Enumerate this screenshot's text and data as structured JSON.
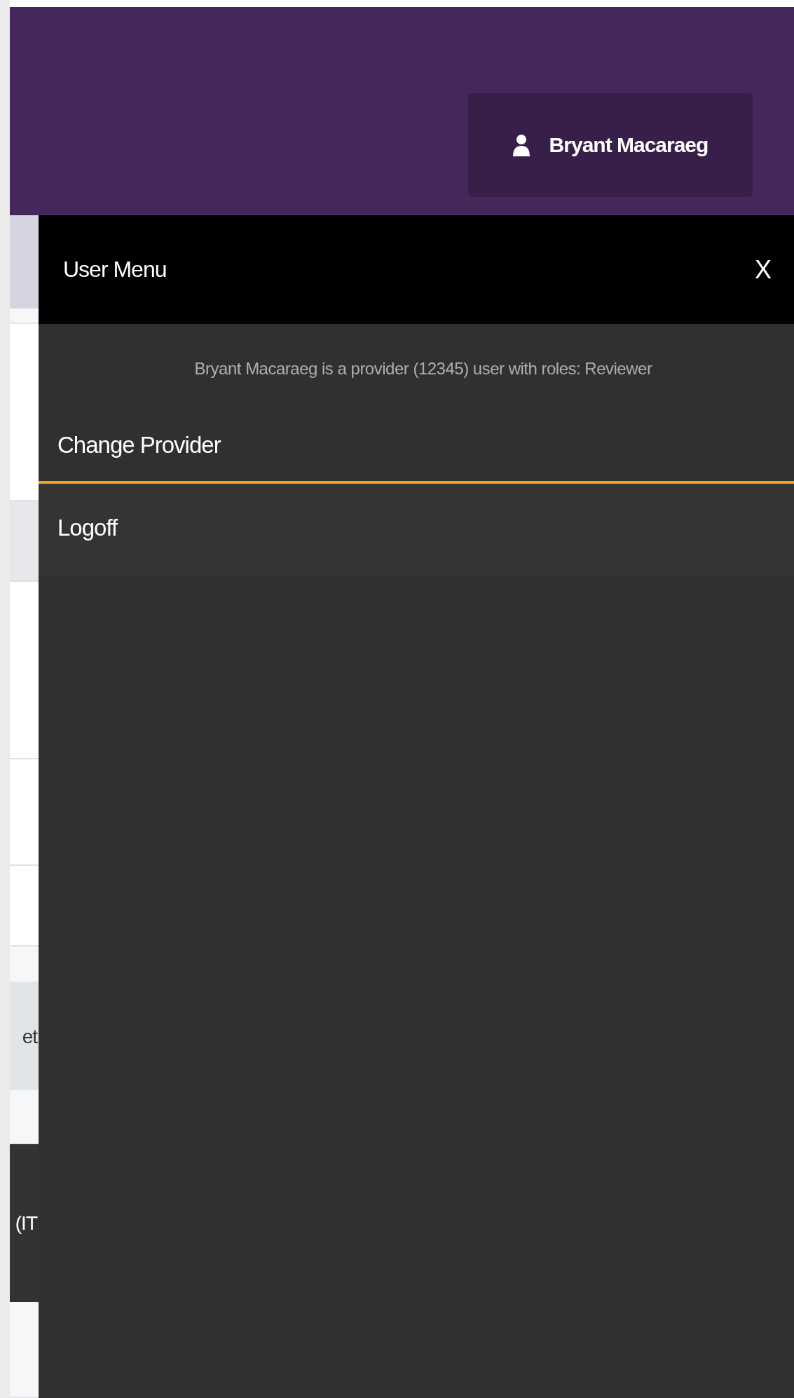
{
  "header": {
    "user_button": {
      "label": "Bryant Macaraeg"
    }
  },
  "background": {
    "fragments": [
      "et",
      "(IT"
    ]
  },
  "user_menu": {
    "title": "User Menu",
    "close": "X",
    "info": "Bryant Macaraeg is a provider (12345) user with roles: Reviewer",
    "items": [
      {
        "label": "Change Provider",
        "selected": true
      },
      {
        "label": "Logoff",
        "selected": false
      }
    ]
  }
}
